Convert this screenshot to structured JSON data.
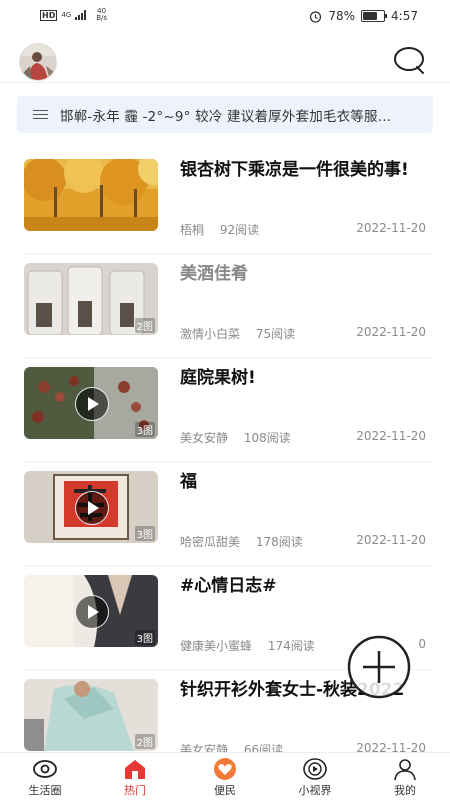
{
  "status_bar": {
    "hd": "HD",
    "network": "4G",
    "speed_value": "40",
    "speed_unit": "B/s",
    "battery_pct": "78%",
    "time": "4:57",
    "battery_level": 0.78
  },
  "header": {
    "avatar_icon": "user-avatar",
    "search_icon": "search-icon"
  },
  "weather": {
    "icon": "menu-icon",
    "text": "邯郸-永年 霾 -2°~9° 较冷 建议着厚外套加毛衣等服..."
  },
  "feed": [
    {
      "title": "银杏树下乘凉是一件很美的事!",
      "author": "梧桐",
      "views": "92阅读",
      "date": "2022-11-20",
      "count": "",
      "video": false,
      "dimmed": false
    },
    {
      "title": "美酒佳肴",
      "author": "激情小白菜",
      "views": "75阅读",
      "date": "2022-11-20",
      "count": "2图",
      "video": false,
      "dimmed": true
    },
    {
      "title": "庭院果树!",
      "author": "美女安静",
      "views": "108阅读",
      "date": "2022-11-20",
      "count": "3图",
      "video": true,
      "dimmed": false
    },
    {
      "title": "福",
      "author": "哈密瓜甜美",
      "views": "178阅读",
      "date": "2022-11-20",
      "count": "3图",
      "video": true,
      "dimmed": false
    },
    {
      "title": "#心情日志#",
      "author": "健康美小蜜蜂",
      "views": "174阅读",
      "date": "0",
      "count": "3图",
      "video": true,
      "dimmed": false
    },
    {
      "title": "针织开衫外套女士-秋装2022",
      "author": "美女安静",
      "views": "66阅读",
      "date": "2022-11-20",
      "count": "2图",
      "video": false,
      "dimmed": false
    }
  ],
  "fab": {
    "icon": "plus-icon"
  },
  "tabbar": {
    "active_color": "#e53935",
    "items": [
      {
        "label": "生活圈",
        "icon": "eye-icon"
      },
      {
        "label": "热门",
        "icon": "home-icon"
      },
      {
        "label": "便民",
        "icon": "heart-icon"
      },
      {
        "label": "小视界",
        "icon": "video-play-icon"
      },
      {
        "label": "我的",
        "icon": "person-icon"
      }
    ]
  }
}
